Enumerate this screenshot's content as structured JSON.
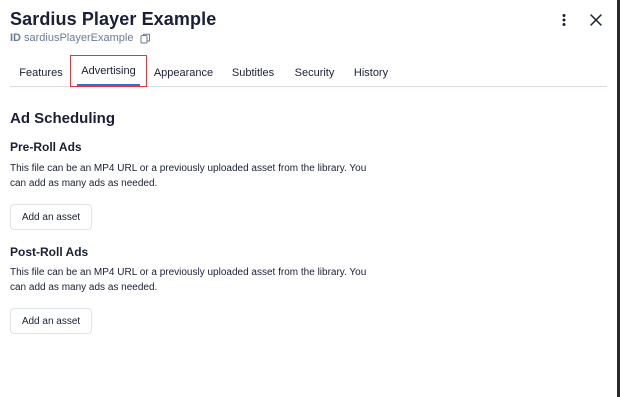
{
  "header": {
    "title": "Sardius Player Example",
    "id_label": "ID",
    "id_value": "sardiusPlayerExample"
  },
  "icons": {
    "copy": "copy-icon",
    "more": "kebab-menu-icon",
    "close": "close-icon"
  },
  "tabs": [
    {
      "label": "Features"
    },
    {
      "label": "Advertising",
      "active": true
    },
    {
      "label": "Appearance"
    },
    {
      "label": "Subtitles"
    },
    {
      "label": "Security"
    },
    {
      "label": "History"
    }
  ],
  "section": {
    "title": "Ad Scheduling",
    "pre_roll": {
      "title": "Pre-Roll Ads",
      "description_line1": "This file can be an MP4 URL or a previously uploaded asset from the library. You",
      "description_line2": "can add as many ads as needed.",
      "button": "Add an asset"
    },
    "post_roll": {
      "title": "Post-Roll Ads",
      "description_line1": "This file can be an MP4 URL or a previously uploaded asset from the library. You",
      "description_line2": "can add as many ads as needed.",
      "button": "Add an asset"
    }
  },
  "colors": {
    "accent": "#2f6fd6",
    "highlight": "#e5363b",
    "text": "#1a1f36",
    "muted": "#6b7a99"
  }
}
